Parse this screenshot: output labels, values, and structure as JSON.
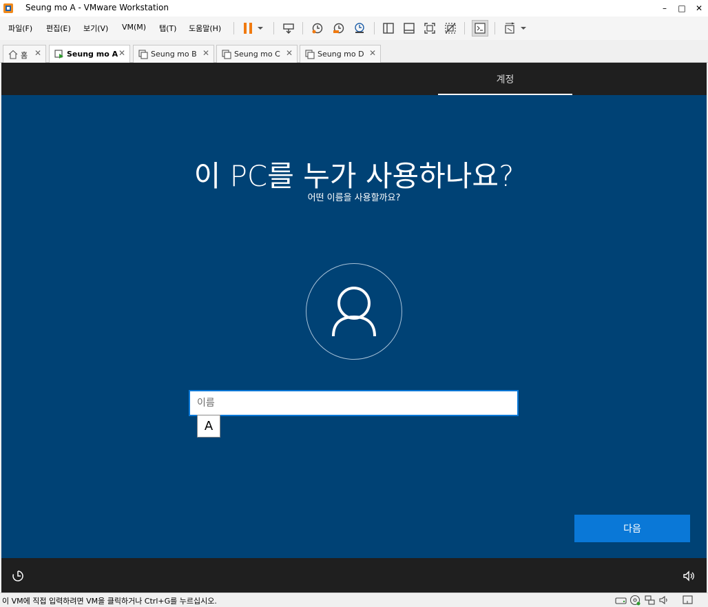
{
  "window": {
    "title": "Seung mo A - VMware Workstation",
    "minimize_glyph": "–",
    "maximize_glyph": "□",
    "close_glyph": "✕"
  },
  "menu": [
    {
      "label": "파일(F)"
    },
    {
      "label": "편집(E)"
    },
    {
      "label": "보기(V)"
    },
    {
      "label": "VM(M)"
    },
    {
      "label": "탭(T)"
    },
    {
      "label": "도움말(H)"
    }
  ],
  "toolbar": {
    "icons": [
      "pause-icon",
      "dropdown-arrow-icon",
      "send-keys-icon",
      "snapshot-icon",
      "revert-snapshot-icon",
      "snapshot-manager-icon",
      "show-library-icon",
      "thumbnail-bar-icon",
      "full-screen-icon",
      "unity-icon",
      "console-view-icon",
      "stretch-guest-icon",
      "dropdown-arrow-icon"
    ]
  },
  "tabs": [
    {
      "label": "홈",
      "icon": "home-icon",
      "active": false
    },
    {
      "label": "Seung mo A",
      "icon": "vm-running-icon",
      "active": true
    },
    {
      "label": "Seung mo B",
      "icon": "vm-icon",
      "active": false
    },
    {
      "label": "Seung mo C",
      "icon": "vm-icon",
      "active": false
    },
    {
      "label": "Seung mo D",
      "icon": "vm-icon",
      "active": false
    }
  ],
  "tab_close_glyph": "✕",
  "oobe": {
    "step_label": "계정",
    "heading": "이 PC를 누가 사용하나요?",
    "subheading": "어떤 이름을 사용할까요?",
    "name_placeholder": "이름",
    "name_value": "",
    "ime_mode": "A",
    "next_label": "다음",
    "colors": {
      "background": "#004275",
      "header_footer": "#1f1f1f",
      "accent": "#0a78d7"
    }
  },
  "statusbar": {
    "text": "이 VM에 직접 입력하려면 VM을 클릭하거나 Ctrl+G를 누르십시오.",
    "icons": [
      "hard-disk-icon",
      "cd-dvd-icon",
      "network-adapter-icon",
      "sound-icon",
      "message-icon"
    ]
  }
}
